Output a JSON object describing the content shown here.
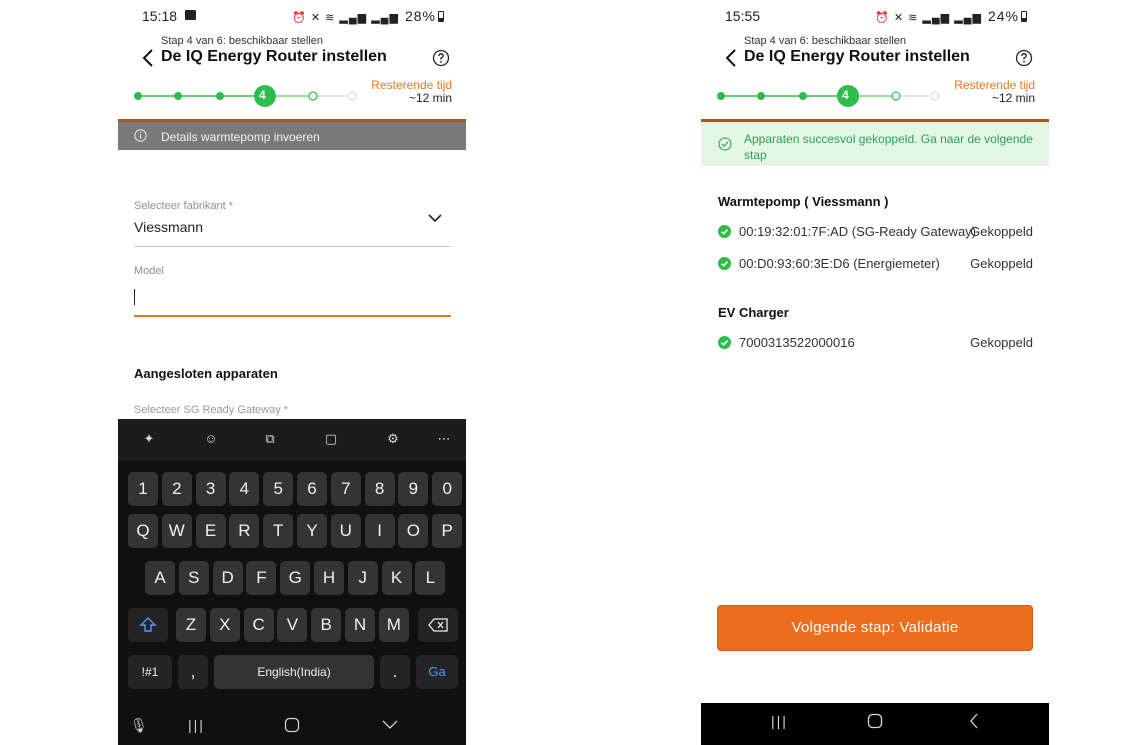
{
  "left": {
    "status": {
      "time": "15:18",
      "battery": "28%"
    },
    "header": {
      "subtitle": "Stap 4 van 6: beschikbaar stellen",
      "title": "De IQ Energy Router instellen"
    },
    "stepper": {
      "current_step": "4",
      "time_label": "Resterende tijd",
      "time_value": "~12 min"
    },
    "info_banner": "Details warmtepomp invoeren",
    "manufacturer": {
      "label": "Selecteer fabrikant *",
      "value": "Viessmann"
    },
    "model": {
      "label": "Model",
      "value": ""
    },
    "section_title": "Aangesloten apparaten",
    "gateway_label": "Selecteer SG Ready Gateway *",
    "keyboard": {
      "row_numbers": [
        "1",
        "2",
        "3",
        "4",
        "5",
        "6",
        "7",
        "8",
        "9",
        "0"
      ],
      "row_1": [
        "Q",
        "W",
        "E",
        "R",
        "T",
        "Y",
        "U",
        "I",
        "O",
        "P"
      ],
      "row_2": [
        "A",
        "S",
        "D",
        "F",
        "G",
        "H",
        "J",
        "K",
        "L"
      ],
      "row_3": [
        "Z",
        "X",
        "C",
        "V",
        "B",
        "N",
        "M"
      ],
      "symbols_key": "!#1",
      "comma_key": ",",
      "space_label": "English(India)",
      "period_key": ".",
      "go_key": "Ga"
    }
  },
  "right": {
    "status": {
      "time": "15:55",
      "battery": "24%"
    },
    "header": {
      "subtitle": "Stap 4 van 6: beschikbaar stellen",
      "title": "De IQ Energy Router instellen"
    },
    "stepper": {
      "current_step": "4",
      "time_label": "Resterende tijd",
      "time_value": "~12 min"
    },
    "success_banner": "Apparaten succesvol gekoppeld. Ga naar de volgende stap",
    "groups": [
      {
        "title": "Warmtepomp ( Viessmann )",
        "devices": [
          {
            "name": "00:19:32:01:7F:AD  (SG-Ready Gateway)",
            "status": "Gekoppeld"
          },
          {
            "name": "00:D0:93:60:3E:D6  (Energiemeter)",
            "status": "Gekoppeld"
          }
        ]
      },
      {
        "title": "EV Charger",
        "devices": [
          {
            "name": "7000313522000016",
            "status": "Gekoppeld"
          }
        ]
      }
    ],
    "next_button": "Volgende stap: Validatie"
  },
  "colors": {
    "accent": "#ec6d1d",
    "success": "#2ebd4a",
    "stepper_green": "#2ebd4a",
    "brown_line": "#a45a1e"
  }
}
